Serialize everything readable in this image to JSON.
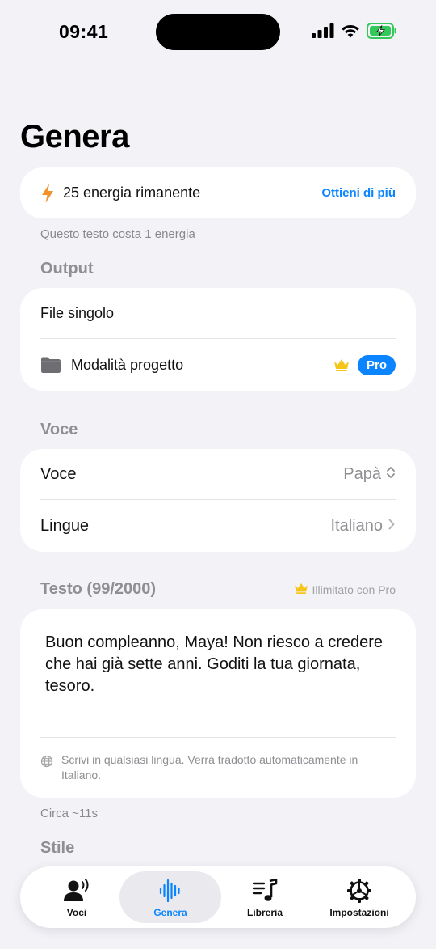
{
  "status_bar": {
    "time": "09:41"
  },
  "page": {
    "title": "Genera"
  },
  "energy": {
    "remaining_text": "25 energia rimanente",
    "get_more_label": "Ottieni di più",
    "cost_note": "Questo testo costa 1 energia"
  },
  "output": {
    "section_title": "Output",
    "single_file_label": "File singolo",
    "project_mode_label": "Modalità progetto",
    "pro_badge": "Pro"
  },
  "voice": {
    "section_title": "Voce",
    "voice_label": "Voce",
    "voice_value": "Papà",
    "languages_label": "Lingue",
    "languages_value": "Italiano"
  },
  "text": {
    "section_title": "Testo (99/2000)",
    "unlimited_note": "Illimitato con Pro",
    "content": "Buon compleanno, Maya! Non riesco a credere che hai già sette anni. Goditi la tua giornata, tesoro.",
    "hint": "Scrivi in qualsiasi lingua. Verrà tradotto automaticamente in Italiano.",
    "duration_note": "Circa ~11s"
  },
  "style": {
    "section_title": "Stile"
  },
  "tab_bar": {
    "tabs": [
      {
        "label": "Voci",
        "icon": "person-wave-icon"
      },
      {
        "label": "Genera",
        "icon": "waveform-icon"
      },
      {
        "label": "Libreria",
        "icon": "music-list-icon"
      },
      {
        "label": "Impostazioni",
        "icon": "gear-icon"
      }
    ],
    "active_tab": "Genera"
  },
  "colors": {
    "accent": "#0a84ff",
    "energy_bolt": "#f2922a",
    "crown": "#f5c518",
    "background": "#f2f2f7",
    "battery": "#34c759"
  }
}
